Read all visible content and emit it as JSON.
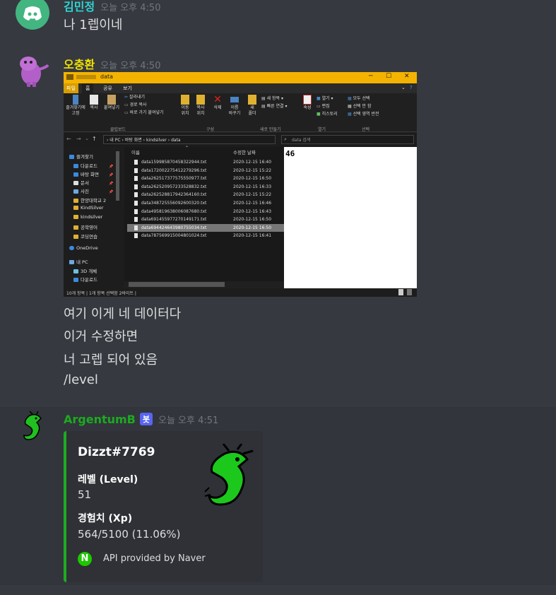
{
  "messages": [
    {
      "author": "김민정",
      "author_color": "#2ed4d4",
      "timestamp": "오늘 오후 4:50",
      "lines": [
        "나 1렙이네"
      ]
    },
    {
      "author": "오충환",
      "author_color": "#f0e000",
      "timestamp": "오늘 오후 4:50",
      "lines": [
        "여기 이게 네 데이터다",
        "이거 수정하면",
        "너 고렙 되어 있음",
        "/level"
      ]
    },
    {
      "author": "ArgentumB",
      "author_color": "#1cab20",
      "bot_badge": "봇",
      "timestamp": "오늘 오후 4:51"
    }
  ],
  "explorer": {
    "window_title": "data",
    "tabs": {
      "file": "파일",
      "home": "홈",
      "share": "공유",
      "view": "보기"
    },
    "ribbon": {
      "pin": "즐겨찾기에\n고정",
      "copy": "복사",
      "paste": "붙여넣기",
      "cut": "잘라내기",
      "copy_path": "경로 복사",
      "paste_shortcut": "바로 가기 붙여넣기",
      "move_to": "이동\n위치",
      "copy_to": "복사\n위치",
      "delete": "삭제",
      "rename": "이름\n바꾸기",
      "new_folder": "새\n폴더",
      "new_item": "새 항목",
      "easy_access": "빠른 연결",
      "properties": "속성",
      "open": "열기",
      "edit": "편집",
      "history": "히스토리",
      "select_all": "모두 선택",
      "select_none": "선택 안 함",
      "invert_selection": "선택 영역 반전",
      "group_clipboard": "클립보드",
      "group_organize": "구성",
      "group_new": "새로 만들기",
      "group_open": "열기",
      "group_select": "선택"
    },
    "address": "› 내 PC › 바탕 화면 › kindsilver › data",
    "search_placeholder": "data 검색",
    "nav": [
      "즐겨찾기",
      "다운로드",
      "바탕 화면",
      "문서",
      "사진",
      "한양대학교 2",
      "KindSilver",
      "kindsilver",
      "공학영어",
      "코딩연습",
      "OneDrive",
      "내 PC",
      "3D 개체",
      "다운로드"
    ],
    "columns": {
      "name": "이름",
      "modified": "수정한 날짜"
    },
    "files": [
      {
        "name": "data159985870458322944.txt",
        "date": "2020-12-15 16:40"
      },
      {
        "name": "data172002275412279296.txt",
        "date": "2020-12-15 15:22"
      },
      {
        "name": "data262517377575550977.txt",
        "date": "2020-12-15 16:50"
      },
      {
        "name": "data262520957233528832.txt",
        "date": "2020-12-15 16:33"
      },
      {
        "name": "data262528817942364160.txt",
        "date": "2020-12-15 15:22"
      },
      {
        "name": "data348725556092600320.txt",
        "date": "2020-12-15 16:46"
      },
      {
        "name": "data495819638006087680.txt",
        "date": "2020-12-15 16:43"
      },
      {
        "name": "data691455977270149171.txt",
        "date": "2020-12-15 16:50"
      },
      {
        "name": "data694424643980755034.txt",
        "date": "2020-12-15 16:50",
        "selected": true
      },
      {
        "name": "data787569915004801024.txt",
        "date": "2020-12-15 16:41"
      }
    ],
    "preview_text": "46",
    "status": "10개 항목  |  1개 항목 선택함 2바이트  |"
  },
  "embed": {
    "accent": "#1cab20",
    "title": "Dizzt#7769",
    "field1_label": "레벨 (Level)",
    "field1_value": "51",
    "field2_label": "경험치 (Xp)",
    "field2_value": "564/5100 (11.06%)",
    "footer_icon": "N",
    "footer_text": "API provided by Naver"
  }
}
